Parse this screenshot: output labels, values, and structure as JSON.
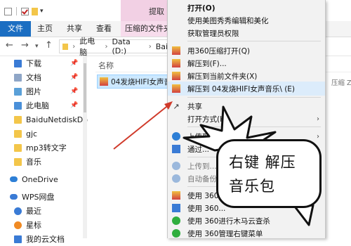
{
  "title_bar": {
    "extract_tab_label": "提取"
  },
  "ribbon": {
    "tabs": [
      "文件",
      "主页",
      "共享",
      "查看",
      "压缩的文件夹"
    ]
  },
  "address_bar": {
    "path": [
      "此电脑",
      "Data (D:)",
      "Baidu"
    ]
  },
  "nav_pane": {
    "items": [
      {
        "label": "下载",
        "icon": "download-icon",
        "pinned": true
      },
      {
        "label": "文档",
        "icon": "document-icon",
        "pinned": true
      },
      {
        "label": "图片",
        "icon": "pictures-icon",
        "pinned": true
      },
      {
        "label": "此电脑",
        "icon": "computer-icon",
        "pinned": true
      },
      {
        "label": "BaiduNetdiskDo",
        "icon": "folder-icon",
        "pinned": false
      },
      {
        "label": "gjc",
        "icon": "folder-icon",
        "pinned": false
      },
      {
        "label": "mp3转文字",
        "icon": "folder-icon",
        "pinned": false
      },
      {
        "label": "音乐",
        "icon": "folder-icon",
        "pinned": false
      },
      {
        "label": "OneDrive",
        "icon": "cloud-icon",
        "pinned": false
      },
      {
        "label": "WPS网盘",
        "icon": "cloud-icon",
        "pinned": false
      },
      {
        "label": "最近",
        "icon": "clock-icon",
        "pinned": false
      },
      {
        "label": "星标",
        "icon": "star-icon",
        "pinned": false
      },
      {
        "label": "我的云文档",
        "icon": "folder-icon",
        "pinned": false
      }
    ]
  },
  "content": {
    "column_name": "名称",
    "selected_file": "04发烧HIFI女声音",
    "right_tag": "压缩 ZI"
  },
  "context_menu": {
    "items": [
      {
        "label": "打开(O)",
        "bold": true
      },
      {
        "label": "使用美图秀秀编辑和美化"
      },
      {
        "label": "获取管理员权限"
      },
      {
        "label": "用360压缩打开(Q)"
      },
      {
        "label": "解压到(F)..."
      },
      {
        "label": "解压到当前文件夹(X)"
      },
      {
        "label": "解压到 04发烧HIFI女声音乐\\ (E)"
      },
      {
        "label": "共享"
      },
      {
        "label": "打开方式(H)"
      },
      {
        "label": "上传到..."
      },
      {
        "label": "通过..."
      },
      {
        "label": "上传到..."
      },
      {
        "label": "自动备份..."
      },
      {
        "label": "使用 360..."
      },
      {
        "label": "使用 360..."
      },
      {
        "label": "使用 360进行木马云查杀"
      },
      {
        "label": "使用 360管理右键菜单"
      }
    ]
  },
  "callout": {
    "line1": "右键 解压",
    "line2": "音乐包"
  },
  "colors": {
    "accent": "#1b6ec2",
    "extract_tab": "#f2d0e4",
    "selection": "#cce8ff",
    "arrow": "#d03a2a"
  }
}
